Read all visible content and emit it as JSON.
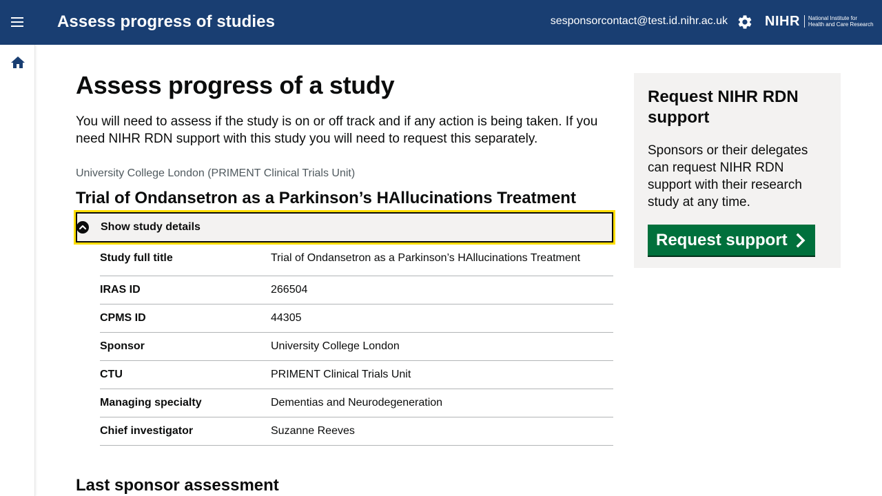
{
  "header": {
    "app_title": "Assess progress of studies",
    "user_email": "sesponsorcontact@test.id.nihr.ac.uk",
    "logo_mark": "NIHR",
    "logo_line1": "National Institute for",
    "logo_line2": "Health and Care Research"
  },
  "icons": {
    "menu": "menu-icon",
    "settings": "gear-icon",
    "home": "home-icon",
    "toggle": "chevron-up-circle-icon",
    "button_chevron": "chevron-right-icon"
  },
  "colors": {
    "header_bg": "#193e72",
    "focus_outline": "#ffdd00",
    "button_green": "#00703c",
    "panel_bg": "#f3f2f1"
  },
  "main": {
    "page_title": "Assess progress of a study",
    "intro": "You will need to assess if the study is on or off track and if any action is being taken. If you need NIHR RDN support with this study you will need to request this separately.",
    "organisation": "University College London (PRIMENT Clinical Trials Unit)",
    "study_title": "Trial of Ondansetron as a Parkinson’s HAllucinations Treatment",
    "details_toggle_label": "Show study details",
    "details": [
      {
        "key": "Study full title",
        "value": "Trial of Ondansetron as a Parkinson’s HAllucinations Treatment"
      },
      {
        "key": "IRAS ID",
        "value": "266504"
      },
      {
        "key": "CPMS ID",
        "value": "44305"
      },
      {
        "key": "Sponsor",
        "value": "University College London"
      },
      {
        "key": "CTU",
        "value": "PRIMENT Clinical Trials Unit"
      },
      {
        "key": "Managing specialty",
        "value": "Dementias and Neurodegeneration"
      },
      {
        "key": "Chief investigator",
        "value": "Suzanne Reeves"
      }
    ],
    "next_section_heading": "Last sponsor assessment"
  },
  "aside": {
    "title": "Request NIHR RDN support",
    "body": "Sponsors or their delegates can request NIHR RDN support with their research study at any time.",
    "button_label": "Request support"
  }
}
